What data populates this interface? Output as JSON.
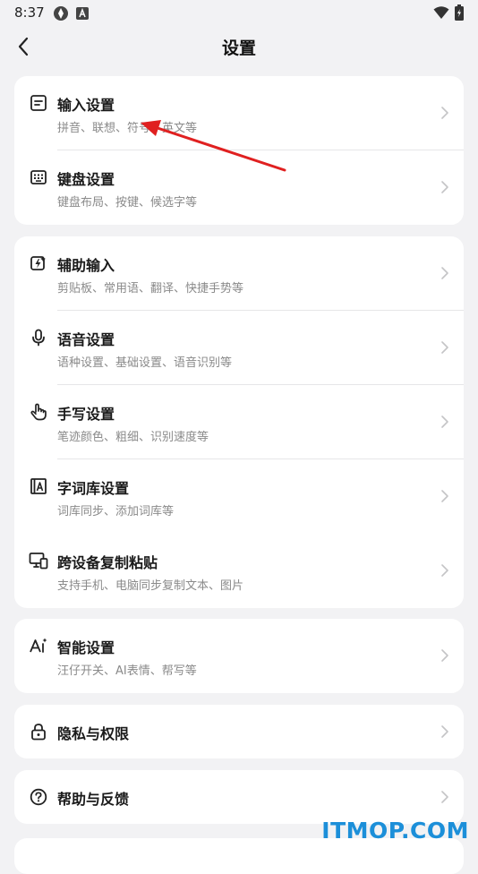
{
  "status_bar": {
    "time": "8:37",
    "icons": [
      "app-icon",
      "a-icon",
      "wifi-icon",
      "battery-icon"
    ]
  },
  "header": {
    "title": "设置",
    "back_icon": "chevron-left-icon"
  },
  "groups": [
    {
      "items": [
        {
          "title": "输入设置",
          "subtitle": "拼音、联想、符号、英文等",
          "icon": "input-settings-icon"
        },
        {
          "title": "键盘设置",
          "subtitle": "键盘布局、按键、候选字等",
          "icon": "keyboard-icon"
        }
      ]
    },
    {
      "items": [
        {
          "title": "辅助输入",
          "subtitle": "剪贴板、常用语、翻译、快捷手势等",
          "icon": "assist-input-icon"
        },
        {
          "title": "语音设置",
          "subtitle": "语种设置、基础设置、语音识别等",
          "icon": "microphone-icon"
        },
        {
          "title": "手写设置",
          "subtitle": "笔迹颜色、粗细、识别速度等",
          "icon": "hand-icon"
        },
        {
          "title": "字词库设置",
          "subtitle": "词库同步、添加词库等",
          "icon": "dictionary-icon"
        },
        {
          "title": "跨设备复制粘贴",
          "subtitle": "支持手机、电脑同步复制文本、图片",
          "icon": "devices-icon"
        }
      ]
    },
    {
      "items": [
        {
          "title": "智能设置",
          "subtitle": "汪仔开关、AI表情、帮写等",
          "icon": "ai-icon"
        }
      ]
    },
    {
      "items": [
        {
          "title": "隐私与权限",
          "icon": "lock-icon"
        }
      ]
    },
    {
      "items": [
        {
          "title": "帮助与反馈",
          "icon": "help-icon"
        }
      ]
    }
  ],
  "annotation": {
    "color": "#e02020"
  },
  "watermark": "ITMOP.COM",
  "colors": {
    "background": "#f2f2f4",
    "card": "#ffffff",
    "subtitle": "#8a8a8a",
    "watermark": "#1c8fd9"
  }
}
